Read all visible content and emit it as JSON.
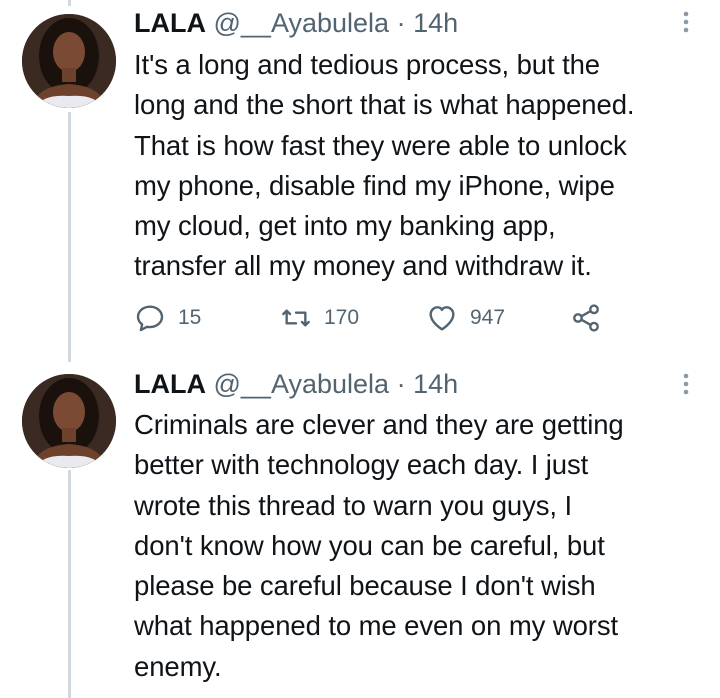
{
  "tweets": [
    {
      "author": {
        "name": "LALA",
        "handle": "@__Ayabulela",
        "separator": "·",
        "time": "14h"
      },
      "text_lines": [
        "It's a long and tedious process, but the",
        "long and the short that is what happened.",
        "That is how fast they were able to unlock",
        "my phone, disable find my iPhone, wipe",
        "my cloud, get into my banking app,",
        "transfer all my money and withdraw it."
      ],
      "actions": {
        "replies": "15",
        "retweets": "170",
        "likes": "947"
      }
    },
    {
      "author": {
        "name": "LALA",
        "handle": "@__Ayabulela",
        "separator": "·",
        "time": "14h"
      },
      "text_lines": [
        "Criminals are clever and they are getting",
        "better with technology each day. I just",
        "wrote this thread to warn you guys, I",
        "don't know how you can be careful, but",
        "please be careful because I don't wish",
        "what happened to me even on my worst",
        "enemy."
      ]
    }
  ],
  "icons": {
    "reply": "reply-icon",
    "retweet": "retweet-icon",
    "like": "heart-icon",
    "share": "share-icon",
    "more": "more-vertical-icon"
  },
  "colors": {
    "text_primary": "#0f1419",
    "text_secondary": "#536471",
    "thread_line": "#cfd9de",
    "background": "#ffffff"
  }
}
